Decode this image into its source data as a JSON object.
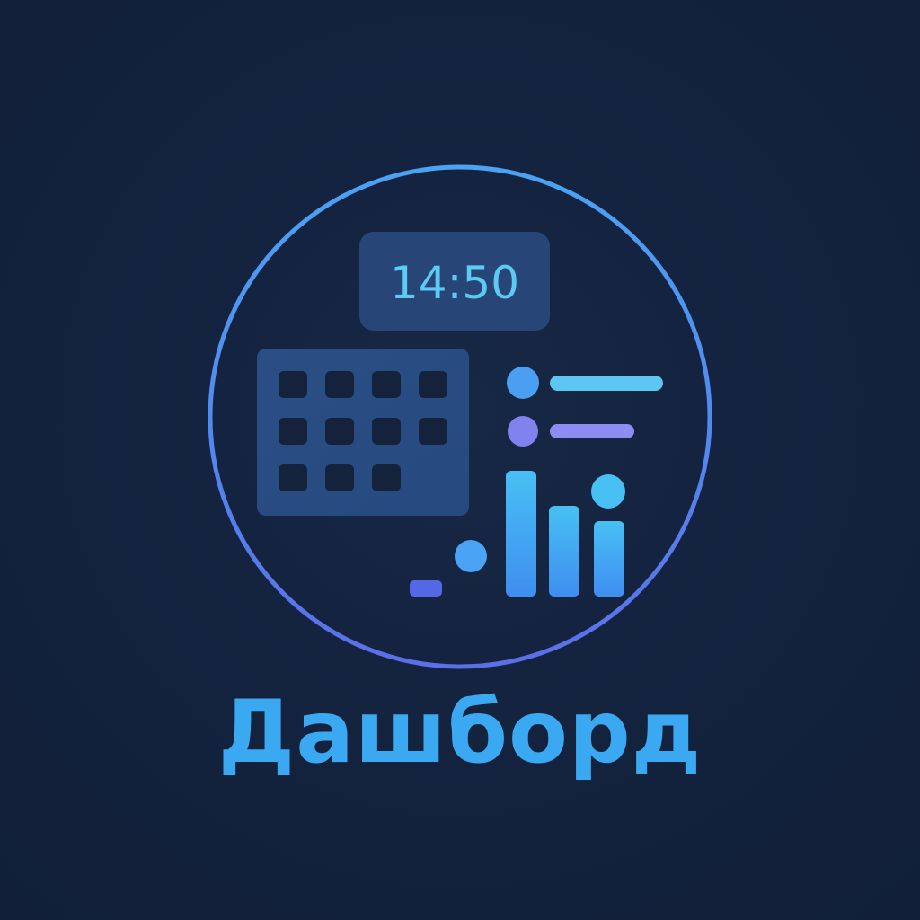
{
  "clock": {
    "time": "14:50"
  },
  "caption": {
    "text": "Дашборд"
  },
  "icons": {
    "frame": "circle-ring-icon",
    "clock": "clock-badge-icon",
    "calendar": "calendar-grid-icon",
    "list": "list-lines-icon",
    "chart": "bar-chart-icon"
  },
  "colors": {
    "background": "#13223d",
    "ring_top": "#4aa3f5",
    "ring_bottom": "#5b73ee",
    "accent_cyan": "#5ccaf2",
    "accent_blue": "#3aa9f2",
    "accent_violet": "#8c8cf2",
    "accent_indigo": "#5a72ea"
  }
}
